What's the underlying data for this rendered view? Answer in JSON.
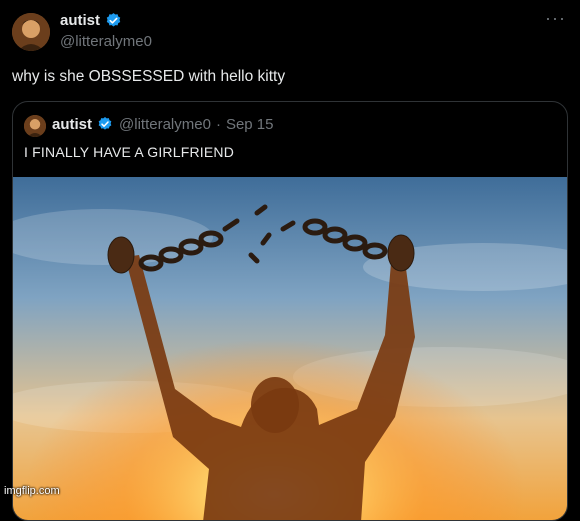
{
  "post": {
    "display_name": "autist",
    "handle": "@litteralyme0",
    "more_label": "···",
    "text": "why is she OBSSESSED with hello kitty",
    "avatar_icon": "profile-photo-icon",
    "verified_icon": "verified-badge-icon"
  },
  "quoted_post": {
    "display_name": "autist",
    "handle": "@litteralyme0",
    "separator": "·",
    "date": "Sep 15",
    "text": "I FINALLY HAVE A GIRLFRIEND"
  },
  "watermark": "imgflip.com",
  "colors": {
    "background": "#000000",
    "text_primary": "#e7e9ea",
    "text_secondary": "#71767b",
    "verified": "#1d9bf0",
    "border": "#2f3336"
  }
}
